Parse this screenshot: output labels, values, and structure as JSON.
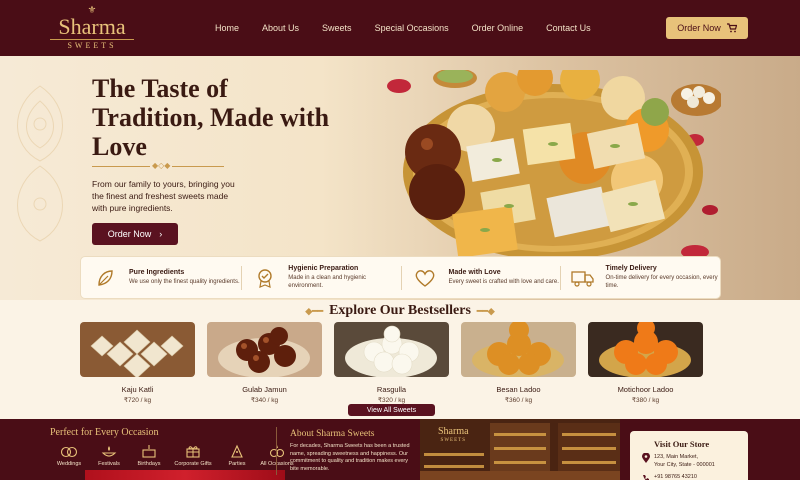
{
  "brand": {
    "name": "Sharma",
    "subtitle": "SWEETS"
  },
  "nav": [
    "Home",
    "About Us",
    "Sweets",
    "Special Occasions",
    "Order Online",
    "Contact Us"
  ],
  "header_cta": "Order Now",
  "hero": {
    "title": "The Taste of Tradition, Made with Love",
    "text": "From our family to yours, bringing you the finest and freshest sweets made with pure ingredients.",
    "cta": "Order Now"
  },
  "features": [
    {
      "icon": "leaf-icon",
      "title": "Pure Ingredients",
      "desc": "We use only the finest quality ingredients."
    },
    {
      "icon": "badge-check-icon",
      "title": "Hygienic Preparation",
      "desc": "Made in a clean and hygienic environment."
    },
    {
      "icon": "heart-icon",
      "title": "Made with Love",
      "desc": "Every sweet is crafted with love and care."
    },
    {
      "icon": "truck-icon",
      "title": "Timely Delivery",
      "desc": "On-time delivery for every occasion, every time."
    }
  ],
  "bestsellers": {
    "title": "Explore Our Bestsellers",
    "items": [
      {
        "name": "Kaju Katli",
        "price": "₹720 / kg"
      },
      {
        "name": "Gulab Jamun",
        "price": "₹340 / kg"
      },
      {
        "name": "Rasgulla",
        "price": "₹320 / kg"
      },
      {
        "name": "Besan Ladoo",
        "price": "₹360 / kg"
      },
      {
        "name": "Motichoor Ladoo",
        "price": "₹380 / kg"
      }
    ],
    "view_all": "View All Sweets"
  },
  "occasions": {
    "title": "Perfect for Every Occasion",
    "items": [
      {
        "icon": "rings-icon",
        "label": "Weddings"
      },
      {
        "icon": "lamp-icon",
        "label": "Festivals"
      },
      {
        "icon": "cake-icon",
        "label": "Birthdays"
      },
      {
        "icon": "gift-icon",
        "label": "Corporate Gifts"
      },
      {
        "icon": "party-icon",
        "label": "Parties"
      },
      {
        "icon": "celebration-icon",
        "label": "All Occasions"
      }
    ]
  },
  "about": {
    "title": "About Sharma Sweets",
    "text": "For decades, Sharma Sweets has been a trusted name, spreading sweetness and happiness. Our commitment to quality and tradition makes every bite memorable."
  },
  "shop_sign": {
    "name": "Sharma",
    "sub": "SWEETS"
  },
  "store": {
    "title": "Visit Our Store",
    "address_line1": "123, Main Market,",
    "address_line2": "Your City, State - 000001",
    "phone": "+91 98765 43210"
  },
  "colors": {
    "maroon": "#4a0d16",
    "gold": "#e8c27a",
    "cream": "#fbf3e6"
  }
}
